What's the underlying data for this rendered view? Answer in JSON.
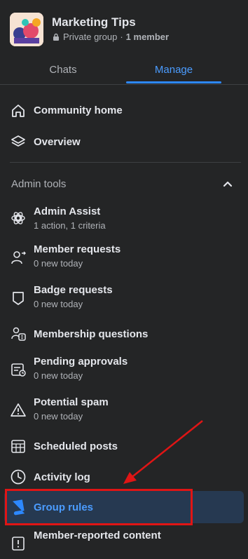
{
  "group": {
    "name": "Marketing Tips",
    "privacy": "Private group",
    "separator": "·",
    "members": "1 member"
  },
  "tabs": [
    {
      "label": "Chats",
      "active": false
    },
    {
      "label": "Manage",
      "active": true
    }
  ],
  "nav": {
    "community_home": "Community home",
    "overview": "Overview"
  },
  "admin_tools": {
    "title": "Admin tools",
    "items": [
      {
        "label": "Admin Assist",
        "sub": "1 action, 1 criteria",
        "icon": "admin-assist-icon"
      },
      {
        "label": "Member requests",
        "sub": "0 new today",
        "icon": "person-arrow-icon"
      },
      {
        "label": "Badge requests",
        "sub": "0 new today",
        "icon": "shield-badge-icon"
      },
      {
        "label": "Membership questions",
        "sub": "",
        "icon": "questions-icon"
      },
      {
        "label": "Pending approvals",
        "sub": "0 new today",
        "icon": "pending-approvals-icon"
      },
      {
        "label": "Potential spam",
        "sub": "0 new today",
        "icon": "warning-triangle-icon"
      },
      {
        "label": "Scheduled posts",
        "sub": "",
        "icon": "calendar-icon"
      },
      {
        "label": "Activity log",
        "sub": "",
        "icon": "clock-icon"
      },
      {
        "label": "Group rules",
        "sub": "",
        "icon": "rules-book-icon",
        "selected": true
      },
      {
        "label": "Member-reported content",
        "sub": "",
        "icon": "report-icon"
      }
    ]
  },
  "colors": {
    "background": "#242526",
    "accent": "#2d88ff",
    "selected_bg": "#263951",
    "annotation": "#e01515"
  }
}
